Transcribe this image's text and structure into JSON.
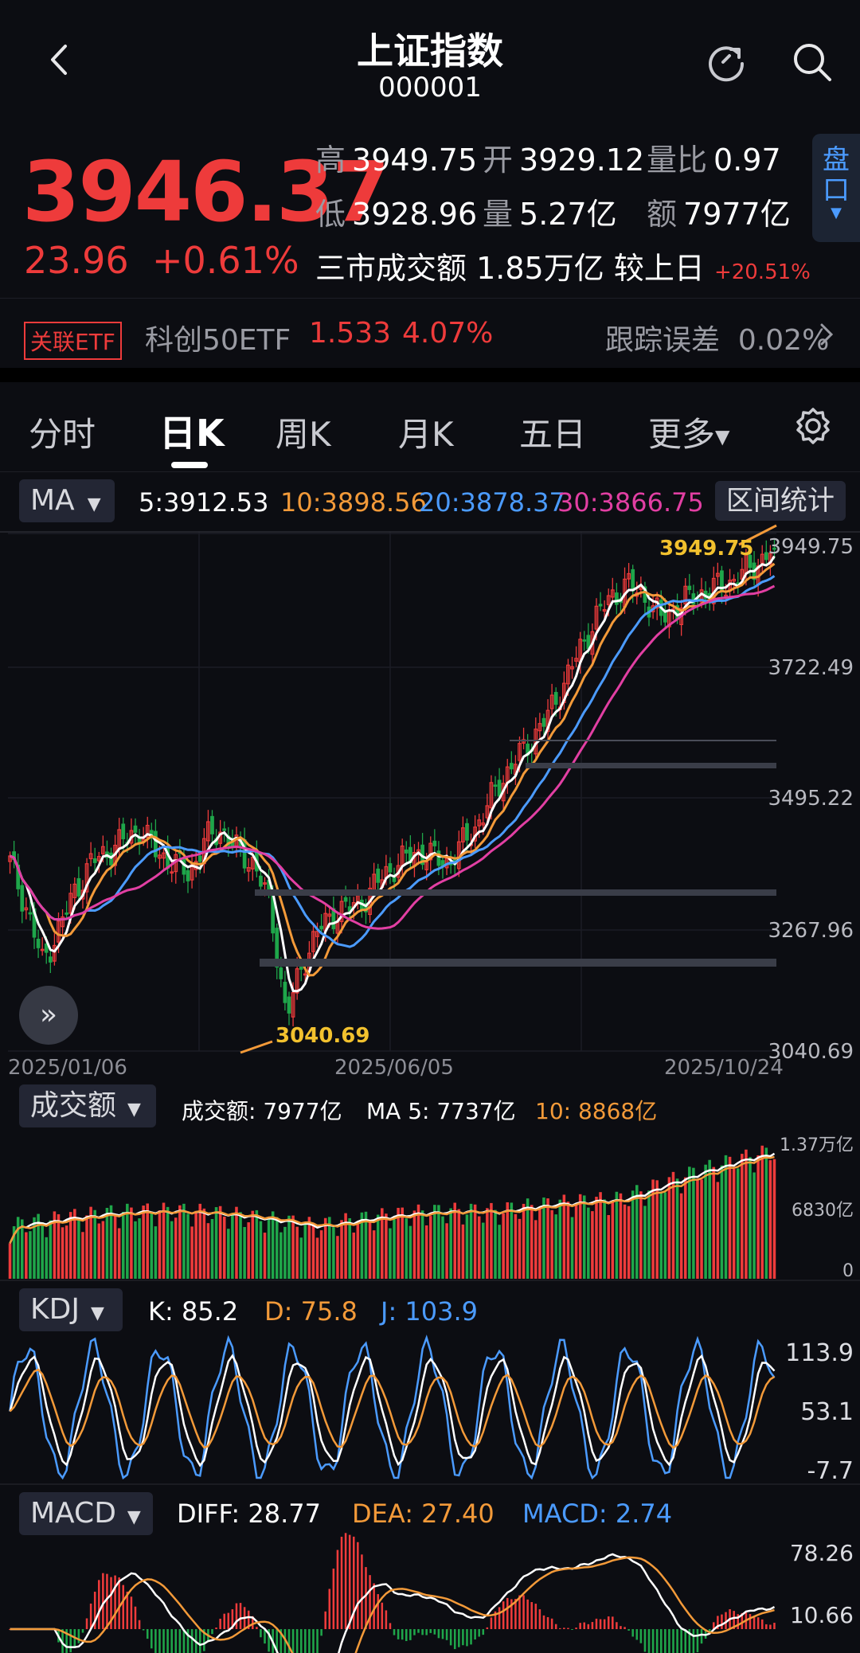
{
  "header": {
    "title": "上证指数",
    "code": "000001"
  },
  "quote": {
    "price": "3946.37",
    "change": "23.96",
    "change_pct": "+0.61%",
    "high_label": "高",
    "high": "3949.75",
    "open_label": "开",
    "open": "3929.12",
    "vr_label": "量比",
    "vr": "0.97",
    "low_label": "低",
    "low": "3928.96",
    "vol_label": "量",
    "vol": "5.27亿",
    "amt_label": "额",
    "amt": "7977亿",
    "turnover_label": "三市成交额",
    "turnover": "1.85万亿",
    "vs_label": "较上日",
    "vs_pct": "+20.51%",
    "pankou": "盘口"
  },
  "etf": {
    "badge": "关联ETF",
    "name": "科创50ETF",
    "price": "1.533",
    "pct": "4.07%",
    "track_label": "跟踪误差",
    "track": "0.02%"
  },
  "tabs": [
    "分时",
    "日K",
    "周K",
    "月K",
    "五日",
    "更多"
  ],
  "active_tab": "日K",
  "main_chart": {
    "indicator": "MA",
    "ma5": "5:3912.53",
    "ma10": "10:3898.56",
    "ma20": "20:3878.37",
    "ma30": "30:3866.75",
    "range_button": "区间统计",
    "y_labels": [
      "3949.75",
      "3722.49",
      "3495.22",
      "3267.96",
      "3040.69"
    ],
    "x_labels": [
      "2025/01/06",
      "2025/06/05",
      "2025/10/24"
    ],
    "high_mark": "3949.75",
    "low_mark": "3040.69"
  },
  "volume_chart": {
    "indicator": "成交额",
    "amt_text": "成交额: 7977亿",
    "ma5_text": "MA 5: 7737亿",
    "ma10_text": "10: 8868亿",
    "y_labels": [
      "1.37万亿",
      "6830亿",
      "0"
    ]
  },
  "kdj_chart": {
    "indicator": "KDJ",
    "k": "K: 85.2",
    "d": "D: 75.8",
    "j": "J: 103.9",
    "y_labels": [
      "113.9",
      "53.1",
      "-7.7"
    ]
  },
  "macd_chart": {
    "indicator": "MACD",
    "diff": "DIFF: 28.77",
    "dea": "DEA: 27.40",
    "macd": "MACD: 2.74",
    "y_labels": [
      "78.26",
      "10.66"
    ]
  },
  "colors": {
    "up": "#ee3b3b",
    "down": "#1fa64a",
    "ma5": "#ffffff",
    "ma10": "#f39a39",
    "ma20": "#4b9bff",
    "ma30": "#e23fa3",
    "accent": "#4b9bff"
  },
  "chart_data": {
    "type": "candlestick",
    "title": "上证指数 日K",
    "ylim": [
      3040.69,
      3949.75
    ],
    "x_range": [
      "2025/01/06",
      "2025/10/24"
    ],
    "approx_close_path": [
      3380,
      3300,
      3200,
      3260,
      3330,
      3380,
      3400,
      3420,
      3440,
      3400,
      3380,
      3360,
      3420,
      3440,
      3400,
      3380,
      3300,
      3100,
      3200,
      3260,
      3290,
      3300,
      3320,
      3360,
      3380,
      3400,
      3390,
      3380,
      3420,
      3460,
      3520,
      3560,
      3600,
      3640,
      3700,
      3760,
      3820,
      3860,
      3880,
      3860,
      3820,
      3840,
      3860,
      3870,
      3880,
      3900,
      3920,
      3946.37
    ],
    "last_close": 3946.37
  }
}
